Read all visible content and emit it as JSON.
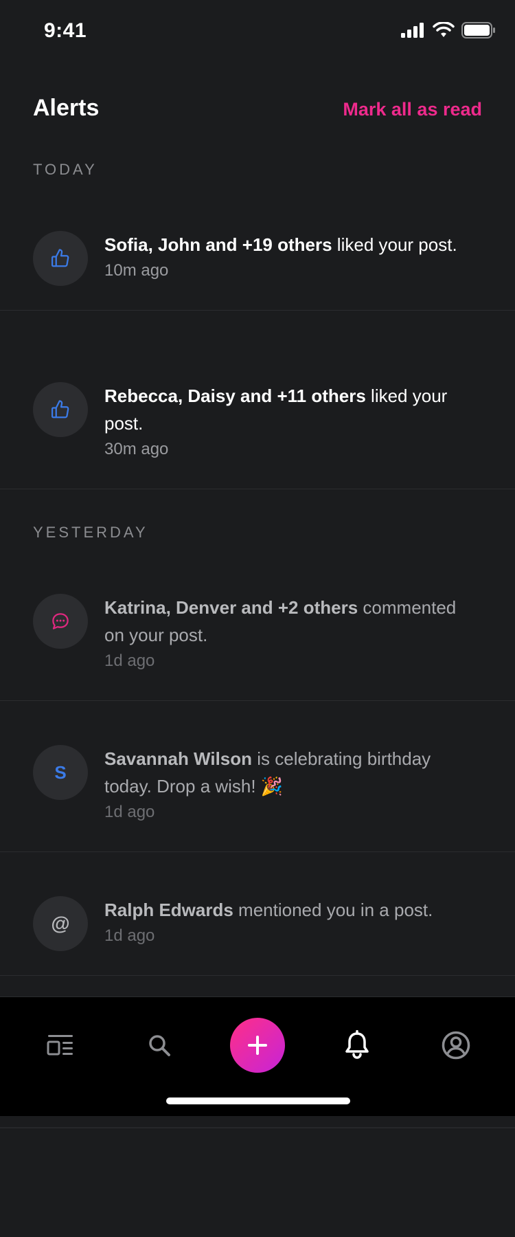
{
  "status_bar": {
    "time": "9:41"
  },
  "header": {
    "title": "Alerts",
    "mark_all_label": "Mark all as read"
  },
  "sections": {
    "today": "TODAY",
    "yesterday": "YESTERDAY"
  },
  "alerts": [
    {
      "icon": "thumbs-up-icon",
      "actor": "Sofia, John and +19 others",
      "action": " liked your post.",
      "time": "10m ago"
    },
    {
      "icon": "thumbs-up-icon",
      "actor": "Rebecca, Daisy and +11 others",
      "action": " liked your post.",
      "time": "30m ago"
    },
    {
      "icon": "comment-icon",
      "actor": "Katrina, Denver and +2 others",
      "action": " commented on your post.",
      "time": "1d ago"
    },
    {
      "icon": "letter-avatar",
      "letter": "S",
      "actor": "Savannah Wilson",
      "action": " is celebrating birthday today. Drop a wish! 🎉",
      "time": "1d ago"
    },
    {
      "icon": "at-icon",
      "letter": "@",
      "actor": "Ralph Edwards",
      "action": " mentioned you in a post.",
      "time": "1d ago"
    }
  ],
  "tab_bar": {
    "items": [
      "feed-icon",
      "search-icon",
      "add-icon",
      "bell-icon",
      "profile-icon"
    ],
    "active": "bell-icon"
  },
  "colors": {
    "background": "#1b1c1e",
    "accent": "#ee2a8c",
    "like_blue": "#3b7be8",
    "comment_pink": "#e0287f"
  }
}
